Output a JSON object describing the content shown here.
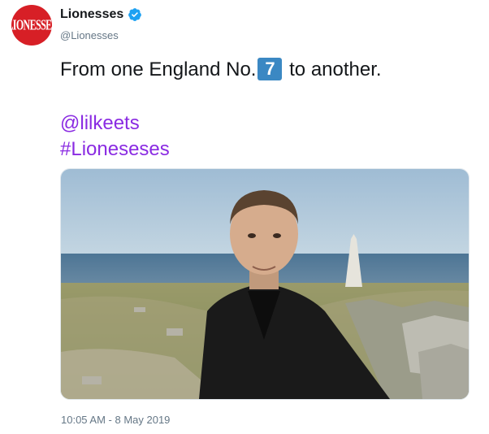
{
  "account": {
    "display_name": "Lionesses",
    "handle": "@Lionesses",
    "avatar_text": "LIONESSES",
    "verified_icon": "verified-badge-icon",
    "brand_color": "#d71f26",
    "verified_color": "#1da1f2"
  },
  "tweet": {
    "text_before": "From one England No.",
    "emoji_number": "7",
    "text_after": " to another.",
    "mention": "@lilkeets",
    "hashtag": "#Lioneseses",
    "link_color": "#8a2be2"
  },
  "media": {
    "type": "video-still",
    "description_icon": "video-thumbnail"
  },
  "meta": {
    "timestamp": "10:05 AM - 8 May 2019"
  }
}
